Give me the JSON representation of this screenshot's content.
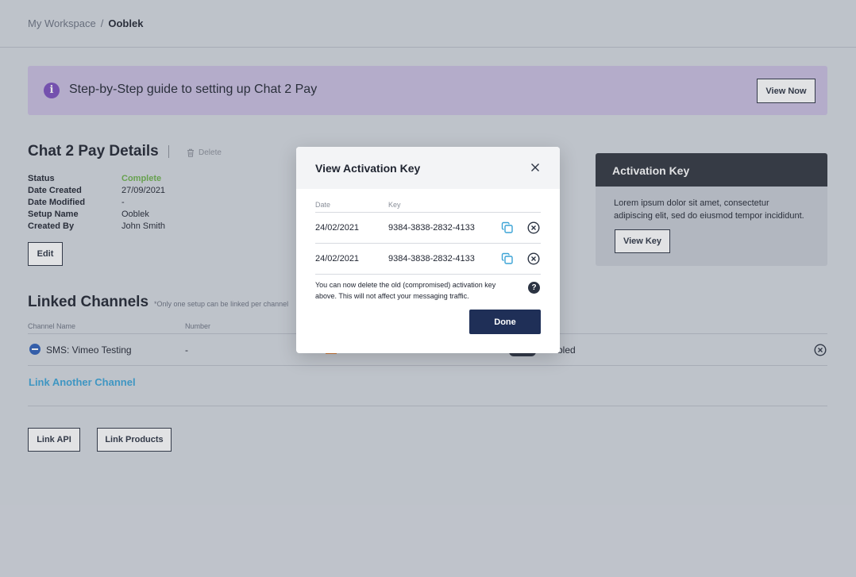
{
  "breadcrumb": {
    "parent": "My Workspace",
    "separator": "/",
    "current": "Ooblek"
  },
  "banner": {
    "text": "Step-by-Step guide to setting up Chat 2 Pay",
    "button": "View Now",
    "icon": "info-icon",
    "color": "#c8bee0"
  },
  "details": {
    "title": "Chat 2 Pay Details",
    "delete_label": "Delete",
    "fields": [
      {
        "key": "Status",
        "value": "Complete"
      },
      {
        "key": "Date Created",
        "value": "27/09/2021"
      },
      {
        "key": "Date Modified",
        "value": "-"
      },
      {
        "key": "Setup Name",
        "value": "Ooblek"
      },
      {
        "key": "Created By",
        "value": "John Smith"
      }
    ],
    "edit_label": "Edit"
  },
  "linked": {
    "title": "Linked Channels",
    "note": "*Only one setup can be linked per channel",
    "columns": {
      "name": "Channel Name",
      "number": "Number"
    },
    "row": {
      "name": "SMS: Vimeo Testing",
      "number": "-",
      "status": "bled"
    },
    "link_another": "Link Another Channel"
  },
  "actions": {
    "link_api": "Link API",
    "link_products": "Link Products"
  },
  "side_card": {
    "title": "Activation Key",
    "body": "Lorem ipsum dolor sit amet, consectetur adipiscing elit, sed do eiusmod tempor incididunt.",
    "button": "View Key"
  },
  "modal": {
    "title": "View Activation Key",
    "columns": {
      "date": "Date",
      "key": "Key"
    },
    "rows": [
      {
        "date": "24/02/2021",
        "key": "9384-3838-2832-4133"
      },
      {
        "date": "24/02/2021",
        "key": "9384-3838-2832-4133"
      }
    ],
    "note": "You can now delete the old (compromised) activation key above. This will not affect your messaging traffic.",
    "done": "Done"
  },
  "colors": {
    "accent": "#1f2f57",
    "link": "#3aa3d6",
    "success": "#6bb04a",
    "info": "#7a4fbd"
  }
}
